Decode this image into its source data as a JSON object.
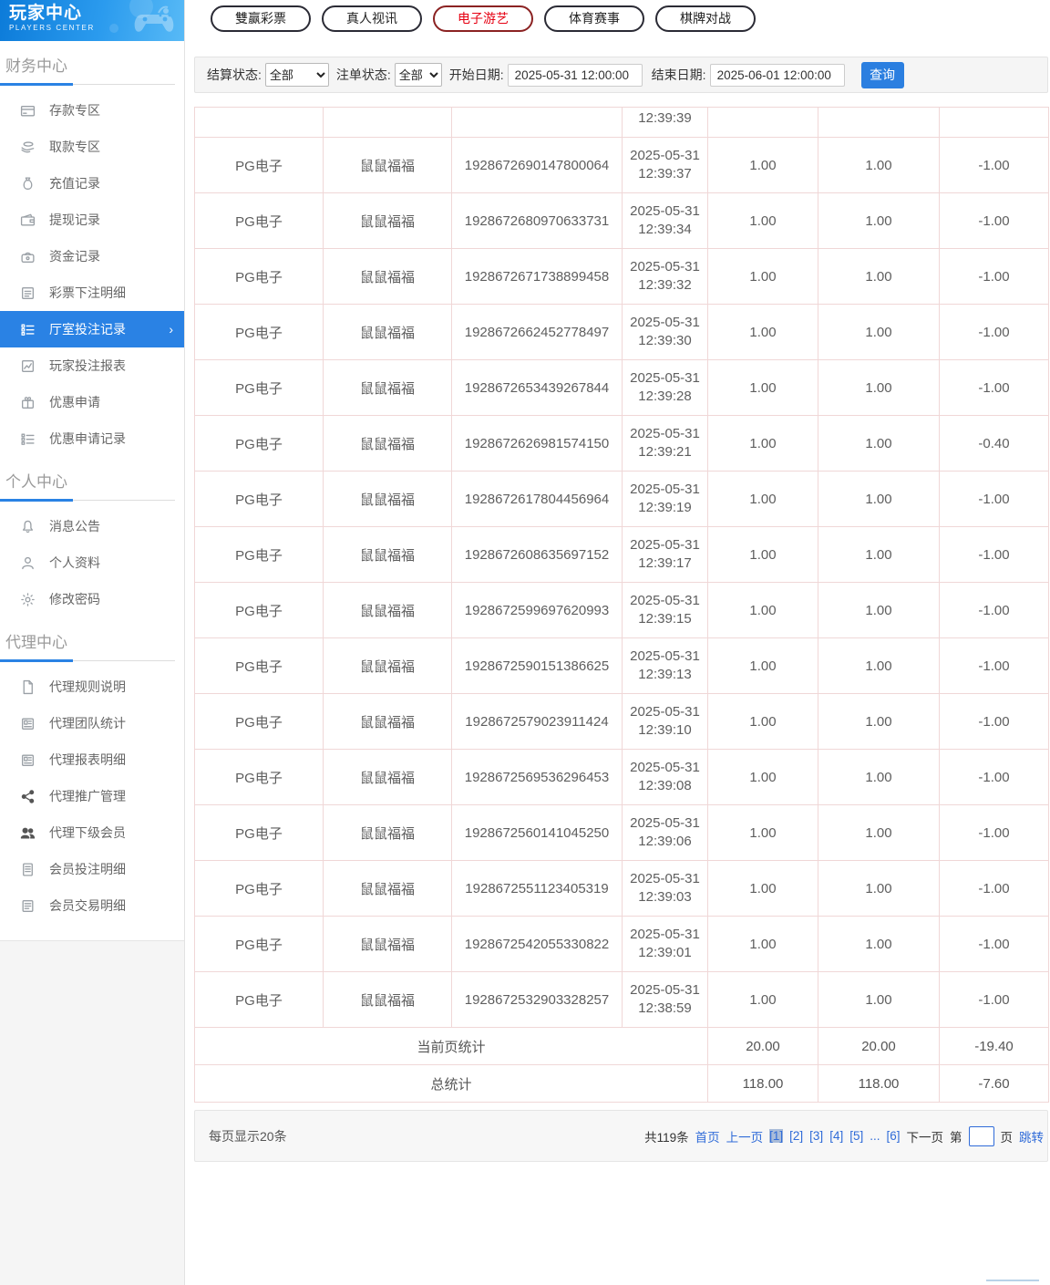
{
  "sidebar": {
    "logo": {
      "title": "玩家中心",
      "subtitle": "PLAYERS CENTER"
    },
    "sections": [
      {
        "title": "财务中心",
        "items": [
          {
            "icon": "deposit-icon",
            "label": "存款专区"
          },
          {
            "icon": "withdraw-icon",
            "label": "取款专区"
          },
          {
            "icon": "recharge-record-icon",
            "label": "充值记录"
          },
          {
            "icon": "withdrawal-record-icon",
            "label": "提现记录"
          },
          {
            "icon": "funds-record-icon",
            "label": "资金记录"
          },
          {
            "icon": "lottery-bet-detail-icon",
            "label": "彩票下注明细"
          },
          {
            "icon": "hall-bet-record-icon",
            "label": "厅室投注记录",
            "active": true
          },
          {
            "icon": "player-bet-report-icon",
            "label": "玩家投注报表"
          },
          {
            "icon": "promo-apply-icon",
            "label": "优惠申请"
          },
          {
            "icon": "promo-apply-record-icon",
            "label": "优惠申请记录"
          }
        ]
      },
      {
        "title": "个人中心",
        "items": [
          {
            "icon": "bell-icon",
            "label": "消息公告"
          },
          {
            "icon": "person-icon",
            "label": "个人资料"
          },
          {
            "icon": "gear-icon",
            "label": "修改密码"
          }
        ]
      },
      {
        "title": "代理中心",
        "items": [
          {
            "icon": "document-icon",
            "label": "代理规则说明"
          },
          {
            "icon": "team-stats-icon",
            "label": "代理团队统计"
          },
          {
            "icon": "report-detail-icon",
            "label": "代理报表明细"
          },
          {
            "icon": "share-icon",
            "label": "代理推广管理",
            "dark": true
          },
          {
            "icon": "members-icon",
            "label": "代理下级会员",
            "dark": true
          },
          {
            "icon": "member-bet-detail-icon",
            "label": "会员投注明细"
          },
          {
            "icon": "member-transaction-icon",
            "label": "会员交易明细"
          }
        ]
      }
    ]
  },
  "topnav": {
    "buttons": [
      {
        "label": "雙赢彩票"
      },
      {
        "label": "真人视讯"
      },
      {
        "label": "电子游艺",
        "active": true
      },
      {
        "label": "体育赛事"
      },
      {
        "label": "棋牌对战"
      }
    ]
  },
  "filters": {
    "settle_status_label": "结算状态:",
    "settle_status_value": "全部",
    "order_status_label": "注单状态:",
    "order_status_value": "全部",
    "start_date_label": "开始日期:",
    "start_date_value": "2025-05-31 12:00:00",
    "end_date_label": "结束日期:",
    "end_date_value": "2025-06-01 12:00:00",
    "search_button": "查询"
  },
  "table": {
    "partial_row_time": "12:39:39",
    "rows": [
      {
        "platform": "PG电子",
        "game": "鼠鼠福福",
        "order_no": "1928672690147800064",
        "date": "2025-05-31",
        "time": "12:39:37",
        "bet": "1.00",
        "valid_bet": "1.00",
        "win_loss": "-1.00"
      },
      {
        "platform": "PG电子",
        "game": "鼠鼠福福",
        "order_no": "1928672680970633731",
        "date": "2025-05-31",
        "time": "12:39:34",
        "bet": "1.00",
        "valid_bet": "1.00",
        "win_loss": "-1.00"
      },
      {
        "platform": "PG电子",
        "game": "鼠鼠福福",
        "order_no": "1928672671738899458",
        "date": "2025-05-31",
        "time": "12:39:32",
        "bet": "1.00",
        "valid_bet": "1.00",
        "win_loss": "-1.00"
      },
      {
        "platform": "PG电子",
        "game": "鼠鼠福福",
        "order_no": "1928672662452778497",
        "date": "2025-05-31",
        "time": "12:39:30",
        "bet": "1.00",
        "valid_bet": "1.00",
        "win_loss": "-1.00"
      },
      {
        "platform": "PG电子",
        "game": "鼠鼠福福",
        "order_no": "1928672653439267844",
        "date": "2025-05-31",
        "time": "12:39:28",
        "bet": "1.00",
        "valid_bet": "1.00",
        "win_loss": "-1.00"
      },
      {
        "platform": "PG电子",
        "game": "鼠鼠福福",
        "order_no": "1928672626981574150",
        "date": "2025-05-31",
        "time": "12:39:21",
        "bet": "1.00",
        "valid_bet": "1.00",
        "win_loss": "-0.40"
      },
      {
        "platform": "PG电子",
        "game": "鼠鼠福福",
        "order_no": "1928672617804456964",
        "date": "2025-05-31",
        "time": "12:39:19",
        "bet": "1.00",
        "valid_bet": "1.00",
        "win_loss": "-1.00"
      },
      {
        "platform": "PG电子",
        "game": "鼠鼠福福",
        "order_no": "1928672608635697152",
        "date": "2025-05-31",
        "time": "12:39:17",
        "bet": "1.00",
        "valid_bet": "1.00",
        "win_loss": "-1.00"
      },
      {
        "platform": "PG电子",
        "game": "鼠鼠福福",
        "order_no": "1928672599697620993",
        "date": "2025-05-31",
        "time": "12:39:15",
        "bet": "1.00",
        "valid_bet": "1.00",
        "win_loss": "-1.00"
      },
      {
        "platform": "PG电子",
        "game": "鼠鼠福福",
        "order_no": "1928672590151386625",
        "date": "2025-05-31",
        "time": "12:39:13",
        "bet": "1.00",
        "valid_bet": "1.00",
        "win_loss": "-1.00"
      },
      {
        "platform": "PG电子",
        "game": "鼠鼠福福",
        "order_no": "1928672579023911424",
        "date": "2025-05-31",
        "time": "12:39:10",
        "bet": "1.00",
        "valid_bet": "1.00",
        "win_loss": "-1.00"
      },
      {
        "platform": "PG电子",
        "game": "鼠鼠福福",
        "order_no": "1928672569536296453",
        "date": "2025-05-31",
        "time": "12:39:08",
        "bet": "1.00",
        "valid_bet": "1.00",
        "win_loss": "-1.00"
      },
      {
        "platform": "PG电子",
        "game": "鼠鼠福福",
        "order_no": "1928672560141045250",
        "date": "2025-05-31",
        "time": "12:39:06",
        "bet": "1.00",
        "valid_bet": "1.00",
        "win_loss": "-1.00"
      },
      {
        "platform": "PG电子",
        "game": "鼠鼠福福",
        "order_no": "1928672551123405319",
        "date": "2025-05-31",
        "time": "12:39:03",
        "bet": "1.00",
        "valid_bet": "1.00",
        "win_loss": "-1.00"
      },
      {
        "platform": "PG电子",
        "game": "鼠鼠福福",
        "order_no": "1928672542055330822",
        "date": "2025-05-31",
        "time": "12:39:01",
        "bet": "1.00",
        "valid_bet": "1.00",
        "win_loss": "-1.00"
      },
      {
        "platform": "PG电子",
        "game": "鼠鼠福福",
        "order_no": "1928672532903328257",
        "date": "2025-05-31",
        "time": "12:38:59",
        "bet": "1.00",
        "valid_bet": "1.00",
        "win_loss": "-1.00"
      }
    ],
    "summary": [
      {
        "label": "当前页统计",
        "bet": "20.00",
        "valid_bet": "20.00",
        "win_loss": "-19.40"
      },
      {
        "label": "总统计",
        "bet": "118.00",
        "valid_bet": "118.00",
        "win_loss": "-7.60"
      }
    ]
  },
  "pagination": {
    "per_page_text": "每页显示20条",
    "total_text": "共119条",
    "first_label": "首页",
    "prev_label": "上一页",
    "pages": [
      "[1]",
      "[2]",
      "[3]",
      "[4]",
      "[5]",
      "...",
      "[6]"
    ],
    "current_page": "[1]",
    "next_label": "下一页",
    "goto_prefix": "第",
    "goto_suffix": "页",
    "goto_button": "跳转"
  },
  "colors": {
    "accent_blue": "#2a82e4",
    "active_red": "#e60012",
    "table_border": "#f0d7d7",
    "link_blue": "#2f6bd8",
    "header_gradient_start": "#0c7bd9",
    "header_gradient_end": "#58baf6"
  }
}
